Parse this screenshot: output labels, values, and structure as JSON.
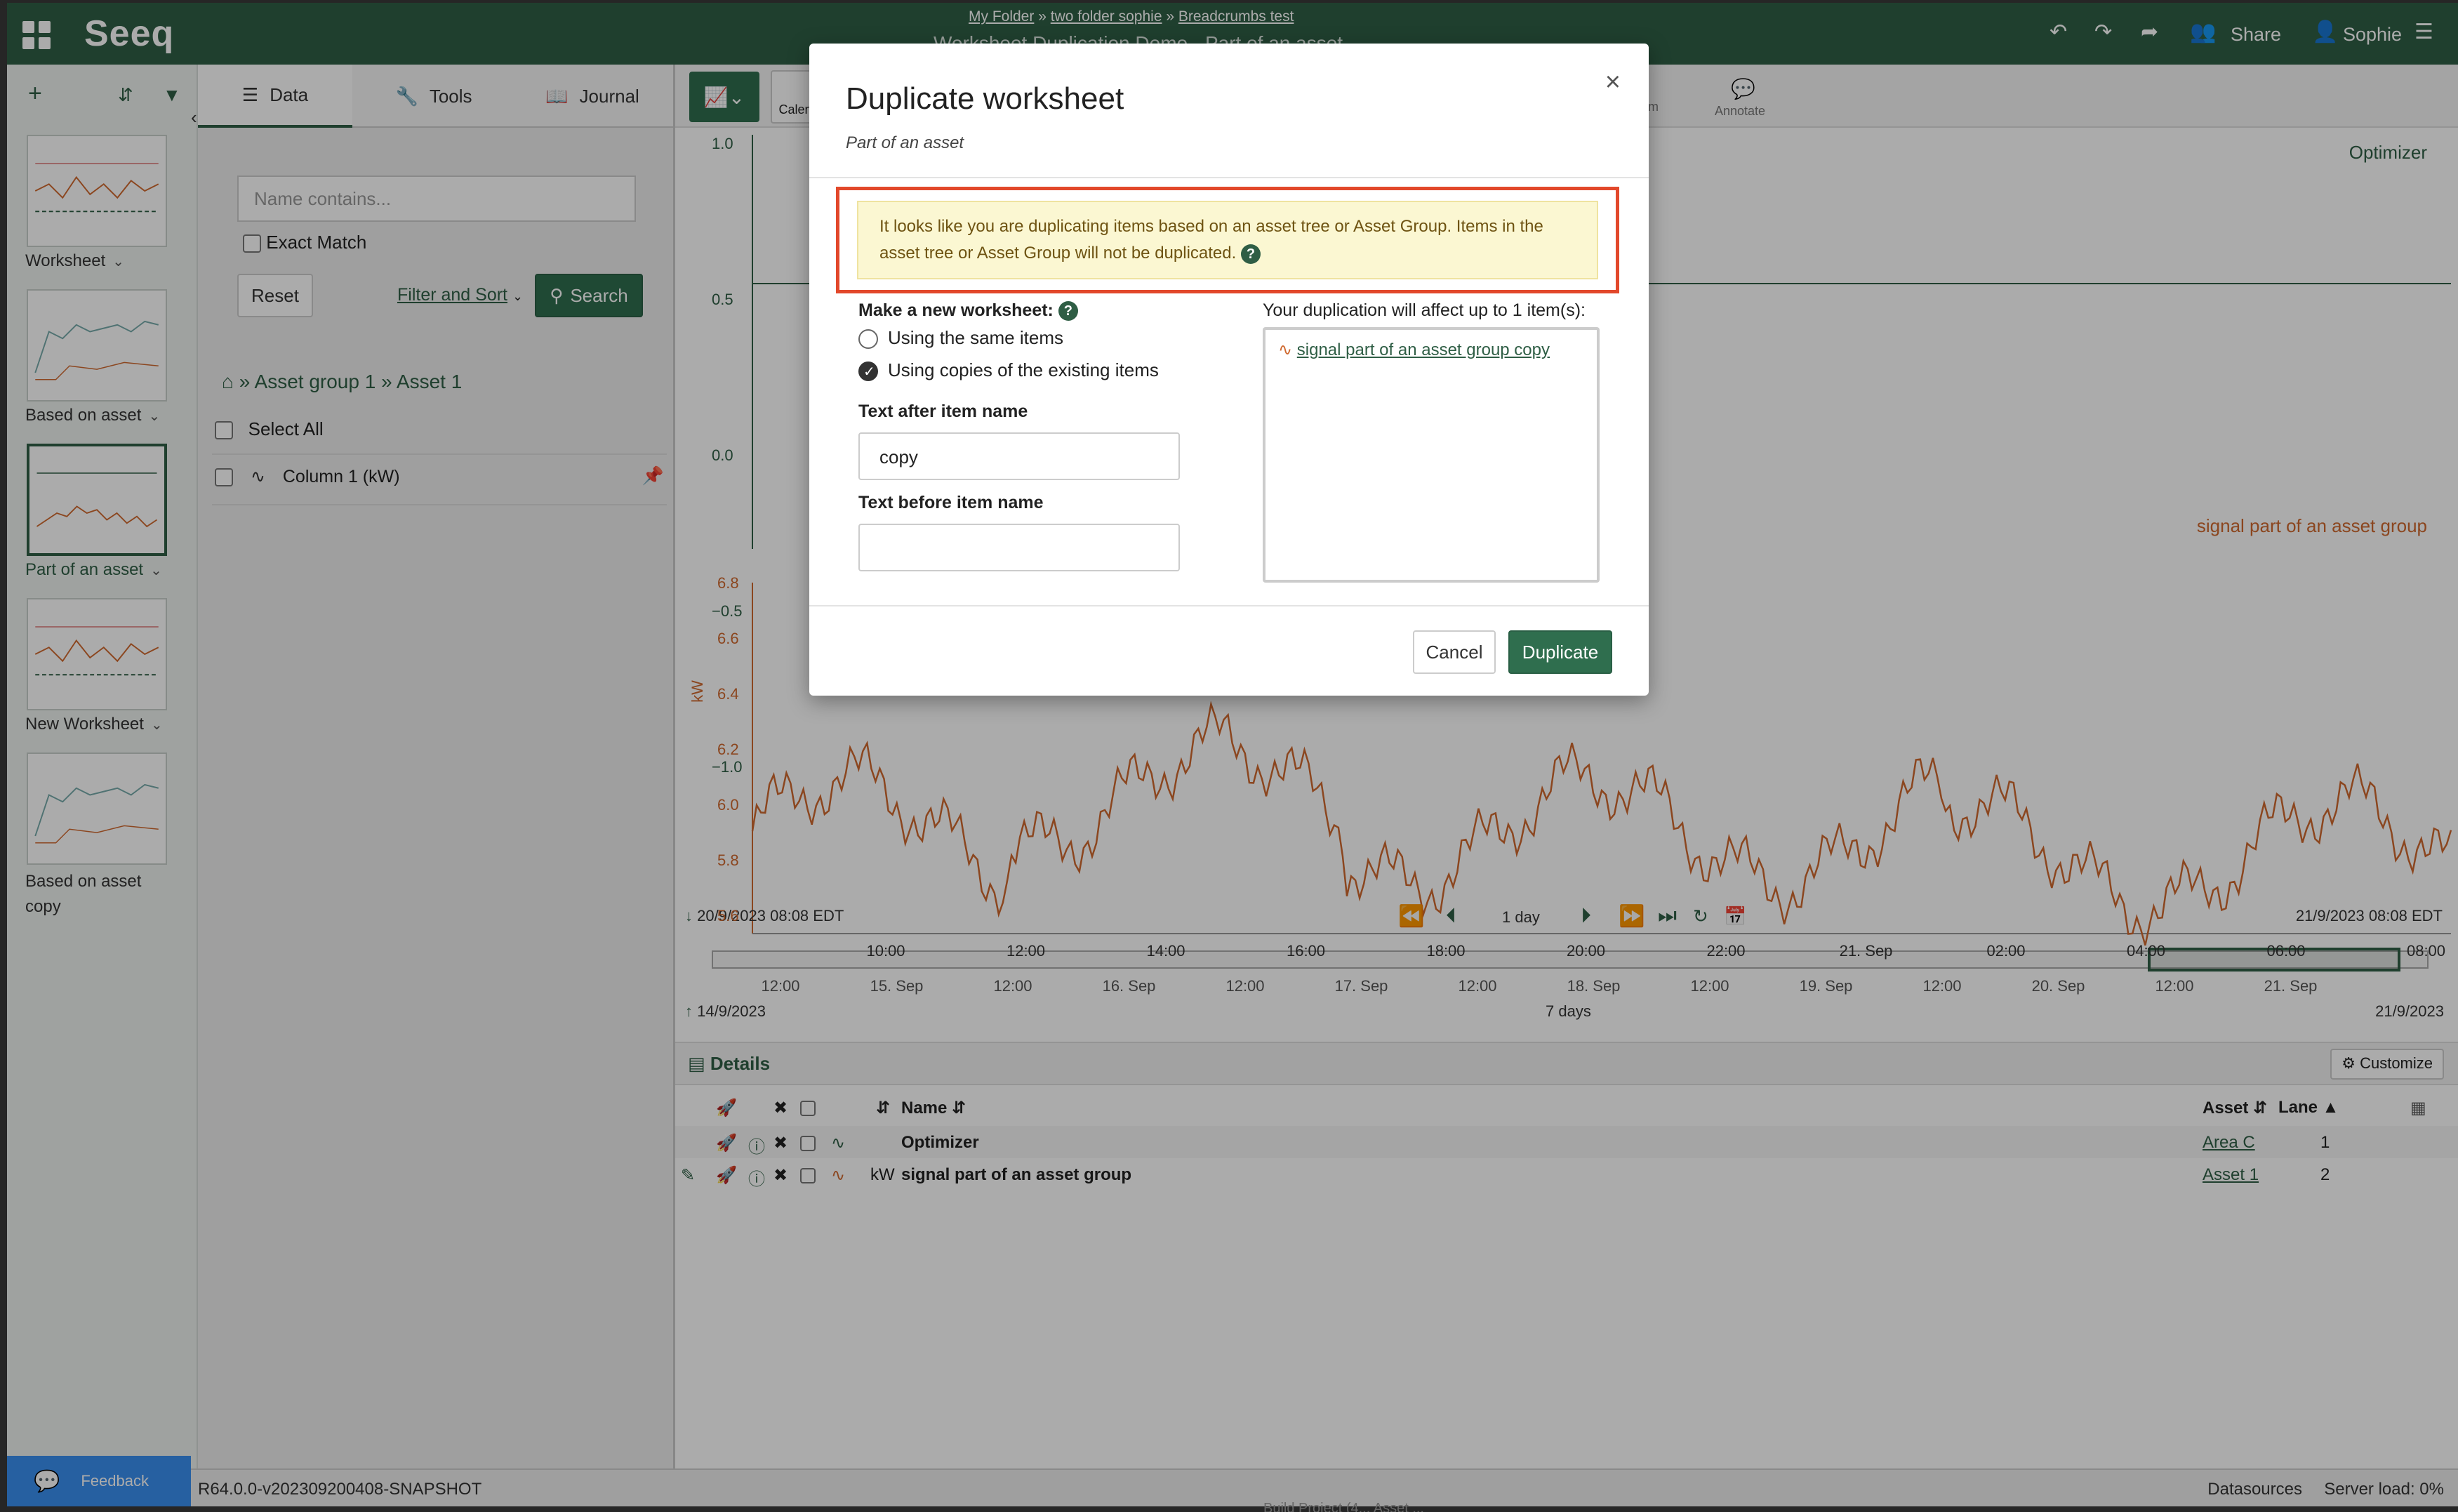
{
  "header": {
    "logo": "Seeq",
    "breadcrumbs": [
      "My Folder",
      "two folder sophie",
      "Breadcrumbs test"
    ],
    "breadcrumb_sep": "»",
    "worksheet_title": "Worksheet Duplication Demo - Part of an asset",
    "share_label": "Share",
    "user_label": "Sophie"
  },
  "rail": {
    "worksheets": [
      {
        "label": "Worksheet"
      },
      {
        "label": "Based on asset"
      },
      {
        "label": "Part of an asset"
      },
      {
        "label": "New Worksheet"
      },
      {
        "label": "Based on asset copy"
      }
    ]
  },
  "panel": {
    "tabs": [
      {
        "label": "Data",
        "icon": "database-icon"
      },
      {
        "label": "Tools",
        "icon": "wrench-icon"
      },
      {
        "label": "Journal",
        "icon": "book-icon"
      }
    ],
    "search_placeholder": "Name contains...",
    "exact_match_label": "Exact Match",
    "reset_label": "Reset",
    "filter_sort_label": "Filter and Sort",
    "search_label": "Search",
    "path": [
      "Asset group 1",
      "Asset 1"
    ],
    "select_all_label": "Select All",
    "items": [
      {
        "label": "Column 1 (kW)"
      }
    ]
  },
  "toolbar": {
    "calendar_label": "Calen",
    "annotate_label": "Annotate",
    "zoom_fragment": "m"
  },
  "trend": {
    "optimizer_label": "Optimizer",
    "signal_label": "signal part of an asset group",
    "upper_y_ticks": [
      "1.0",
      "0.5",
      "0.0",
      "−0.5",
      "−1.0"
    ],
    "lower_y_ticks": [
      "6.8",
      "6.6",
      "6.4",
      "6.2",
      "6.0",
      "5.8",
      "5.6"
    ],
    "y_unit": "kW",
    "x_ticks": [
      "10:00",
      "12:00",
      "14:00",
      "16:00",
      "18:00",
      "20:00",
      "22:00",
      "21. Sep",
      "02:00",
      "04:00",
      "06:00",
      "08:00"
    ],
    "display_start": "20/9/2023 08:08",
    "display_end": "21/9/2023 08:08",
    "tz": "EDT",
    "duration": "1 day",
    "nav_ticks": [
      "12:00",
      "15. Sep",
      "12:00",
      "16. Sep",
      "12:00",
      "17. Sep",
      "12:00",
      "18. Sep",
      "12:00",
      "19. Sep",
      "12:00",
      "20. Sep",
      "12:00",
      "21. Sep"
    ],
    "investigate_start": "14/9/2023",
    "investigate_range": "7 days",
    "investigate_end": "21/9/2023"
  },
  "details": {
    "title": "Details",
    "customize_label": "Customize",
    "columns": {
      "name": "Name",
      "asset": "Asset",
      "lane": "Lane"
    },
    "rows": [
      {
        "unit": "",
        "name": "Optimizer",
        "asset": "Area C",
        "lane": "1"
      },
      {
        "unit": "kW",
        "name": "signal part of an asset group",
        "asset": "Asset 1",
        "lane": "2"
      }
    ]
  },
  "status": {
    "version": "R64.0.0-v202309200408-SNAPSHOT",
    "datasources": "Datasources",
    "server_load": "Server load: 0%",
    "feedback_label": "Feedback",
    "bottom_cut": "Build Project (4... Asset ..."
  },
  "modal": {
    "title": "Duplicate worksheet",
    "subtitle": "Part of an asset",
    "close_glyph": "×",
    "warning": "It looks like you are duplicating items based on an asset tree or Asset Group. Items in the asset tree or Asset Group will not be duplicated.",
    "make_new_label": "Make a new worksheet:",
    "option_same": "Using the same items",
    "option_copies": "Using copies of the existing items",
    "selected_option": "copies",
    "text_after_label": "Text after item name",
    "text_after_value": "copy",
    "text_before_label": "Text before item name",
    "text_before_value": "",
    "affect_label": "Your duplication will affect up to 1 item(s):",
    "affected_items": [
      "signal part of an asset group copy"
    ],
    "cancel_label": "Cancel",
    "duplicate_label": "Duplicate"
  },
  "colors": {
    "brand": "#2f5e45",
    "signal": "#d0692f",
    "warning_border": "#e2482b",
    "warning_bg": "#fbf7d2"
  }
}
